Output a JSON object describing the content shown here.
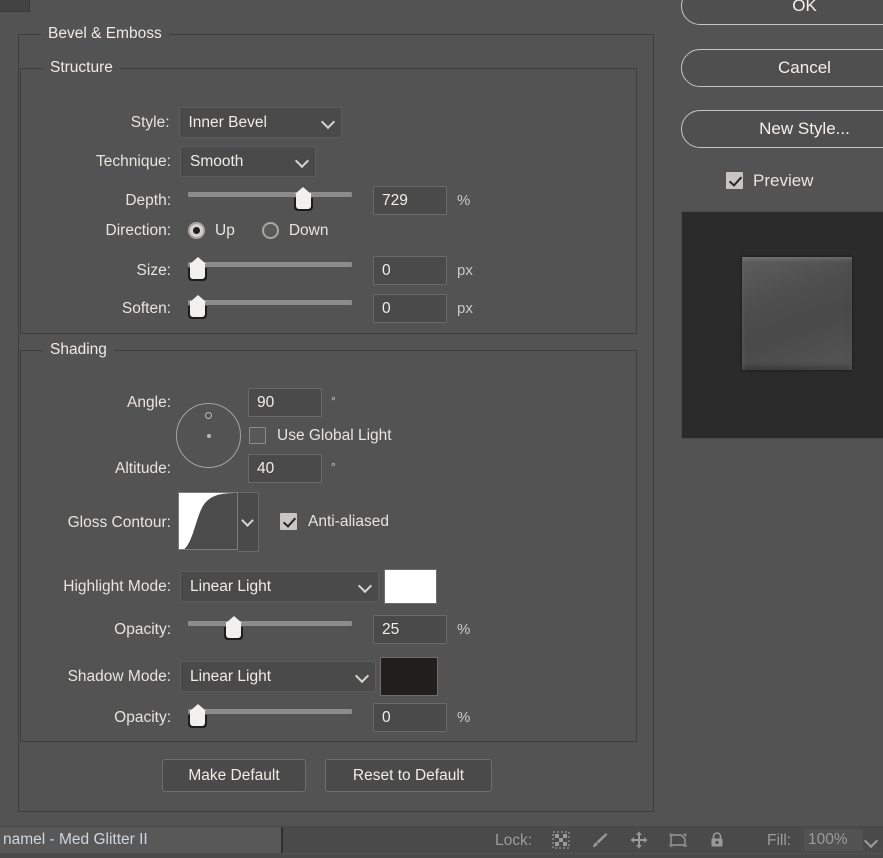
{
  "dialog": {
    "section_title": "Bevel & Emboss",
    "groups": {
      "structure": "Structure",
      "shading": "Shading"
    }
  },
  "structure": {
    "style": {
      "label": "Style:",
      "value": "Inner Bevel"
    },
    "technique": {
      "label": "Technique:",
      "value": "Smooth"
    },
    "depth": {
      "label": "Depth:",
      "value": "729",
      "unit": "%",
      "slider_percent": 73
    },
    "direction": {
      "label": "Direction:",
      "options": [
        "Up",
        "Down"
      ],
      "selected": "Up"
    },
    "size": {
      "label": "Size:",
      "value": "0",
      "unit": "px",
      "slider_percent": 0
    },
    "soften": {
      "label": "Soften:",
      "value": "0",
      "unit": "px",
      "slider_percent": 0
    }
  },
  "shading": {
    "angle": {
      "label": "Angle:",
      "value": "90",
      "unit": "°"
    },
    "use_global_light": {
      "label": "Use Global Light",
      "checked": false
    },
    "altitude": {
      "label": "Altitude:",
      "value": "40",
      "unit": "°"
    },
    "gloss_contour": {
      "label": "Gloss Contour:"
    },
    "anti_aliased": {
      "label": "Anti-aliased",
      "checked": true
    },
    "highlight_mode": {
      "label": "Highlight Mode:",
      "value": "Linear Light",
      "color": "#ffffff"
    },
    "highlight_opacity": {
      "label": "Opacity:",
      "value": "25",
      "unit": "%",
      "slider_percent": 25
    },
    "shadow_mode": {
      "label": "Shadow Mode:",
      "value": "Linear Light",
      "color": "#221e1d"
    },
    "shadow_opacity": {
      "label": "Opacity:",
      "value": "0",
      "unit": "%",
      "slider_percent": 0
    }
  },
  "footer": {
    "make_default": "Make Default",
    "reset_to_default": "Reset to Default"
  },
  "side": {
    "ok": "OK",
    "cancel": "Cancel",
    "new_style": "New Style...",
    "preview": {
      "label": "Preview",
      "checked": true
    }
  },
  "statusbar": {
    "layer_name": "namel - Med Glitter II",
    "lock_label": "Lock:",
    "lock_icons": [
      "lock-transparent-pixels-icon",
      "lock-image-pixels-icon",
      "lock-position-icon",
      "lock-artboard-nesting-icon",
      "lock-all-icon"
    ],
    "fill_label": "Fill:",
    "fill_value": "100%"
  },
  "colors": {
    "dialog_bg": "#535353",
    "field_bg": "#4a4a4a",
    "text": "#efeae6",
    "muted_text": "#9c9c9c",
    "slider_track": "#8c8c8c",
    "preview_bg": "#2b2b2b"
  }
}
